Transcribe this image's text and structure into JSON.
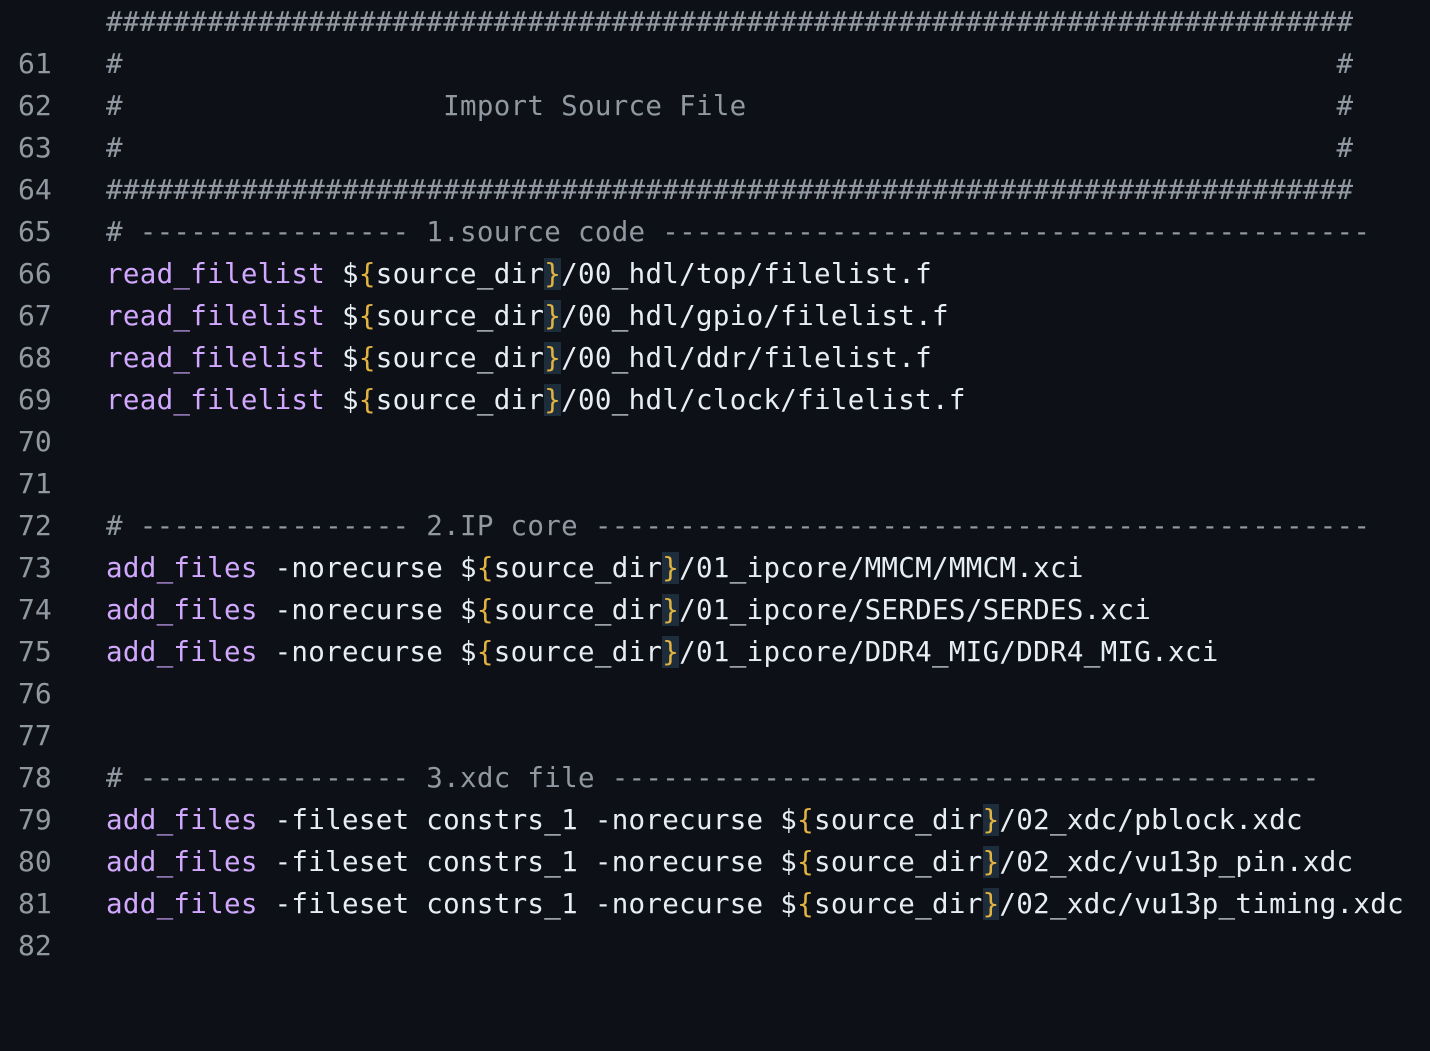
{
  "lines": [
    {
      "n": "61",
      "comment": "##########################################################################"
    },
    {
      "n": "62",
      "comment": "#                                                                        #"
    },
    {
      "n": "63",
      "comment": "#                   Import Source File                                   #"
    },
    {
      "n": "64",
      "comment": "#                                                                        #"
    },
    {
      "n": "65",
      "comment": "##########################################################################"
    },
    {
      "n": "66",
      "comment": "# ---------------- 1.source code ------------------------------------------"
    },
    {
      "n": "67",
      "cmd": "read_filelist",
      "pre": " $",
      "lb": "{",
      "var": "source_dir",
      "rb": "}",
      "path": "/00_hdl/top/filelist.f"
    },
    {
      "n": "68",
      "cmd": "read_filelist",
      "pre": " $",
      "lb": "{",
      "var": "source_dir",
      "rb": "}",
      "path": "/00_hdl/gpio/filelist.f"
    },
    {
      "n": "69",
      "cmd": "read_filelist",
      "pre": " $",
      "lb": "{",
      "var": "source_dir",
      "rb": "}",
      "path": "/00_hdl/ddr/filelist.f"
    },
    {
      "n": "70",
      "cmd": "read_filelist",
      "pre": " $",
      "lb": "{",
      "var": "source_dir",
      "rb": "}",
      "path": "/00_hdl/clock/filelist.f"
    },
    {
      "n": "71"
    },
    {
      "n": "72"
    },
    {
      "n": "73",
      "comment": "# ---------------- 2.IP core ----------------------------------------------"
    },
    {
      "n": "74",
      "cmd": "add_files",
      "pre": " -norecurse $",
      "lb": "{",
      "var": "source_dir",
      "rb": "}",
      "path": "/01_ipcore/MMCM/MMCM.xci"
    },
    {
      "n": "75",
      "cmd": "add_files",
      "pre": " -norecurse $",
      "lb": "{",
      "var": "source_dir",
      "rb": "}",
      "path": "/01_ipcore/SERDES/SERDES.xci"
    },
    {
      "n": "76",
      "cmd": "add_files",
      "pre": " -norecurse $",
      "lb": "{",
      "var": "source_dir",
      "rb": "}",
      "path": "/01_ipcore/DDR4_MIG/DDR4_MIG.xci"
    },
    {
      "n": "77"
    },
    {
      "n": "78"
    },
    {
      "n": "79",
      "comment": "# ---------------- 3.xdc file ------------------------------------------"
    },
    {
      "n": "80",
      "cmd": "add_files",
      "pre": " -fileset constrs_1 -norecurse $",
      "lb": "{",
      "var": "source_dir",
      "rb": "}",
      "path": "/02_xdc/pblock.xdc"
    },
    {
      "n": "81",
      "cmd": "add_files",
      "pre": " -fileset constrs_1 -norecurse $",
      "lb": "{",
      "var": "source_dir",
      "rb": "}",
      "path": "/02_xdc/vu13p_pin.xdc"
    },
    {
      "n": "82",
      "cmd": "add_files",
      "pre": " -fileset constrs_1 -norecurse $",
      "lb": "{",
      "var": "source_dir",
      "rb": "}",
      "path": "/02_xdc/vu13p_timing.xdc"
    }
  ]
}
